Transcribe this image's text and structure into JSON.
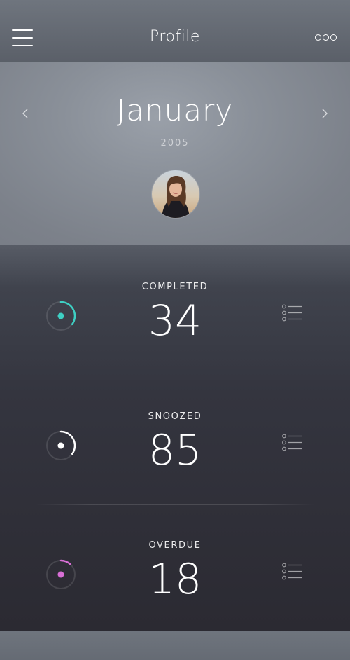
{
  "header": {
    "title": "Profile",
    "menu_icon": "hamburger-menu-icon",
    "more_icon": "more-options-icon"
  },
  "calendar": {
    "month": "January",
    "year": "2005",
    "prev_icon": "chevron-left-icon",
    "next_icon": "chevron-right-icon"
  },
  "profile": {
    "avatar": "user-avatar-photo"
  },
  "stats": [
    {
      "label": "COMPLETED",
      "value": "34",
      "color": "#3ed0c4",
      "progress": 0.35,
      "icon": "list-icon"
    },
    {
      "label": "SNOOZED",
      "value": "85",
      "color": "#ffffff",
      "progress": 0.35,
      "icon": "list-icon"
    },
    {
      "label": "OVERDUE",
      "value": "18",
      "color": "#d86fd6",
      "progress": 0.12,
      "icon": "list-icon"
    }
  ],
  "colors": {
    "background_top": "#6f757e",
    "background_bottom": "#2b2a32",
    "accent_completed": "#3ed0c4",
    "accent_snoozed": "#ffffff",
    "accent_overdue": "#d86fd6"
  }
}
